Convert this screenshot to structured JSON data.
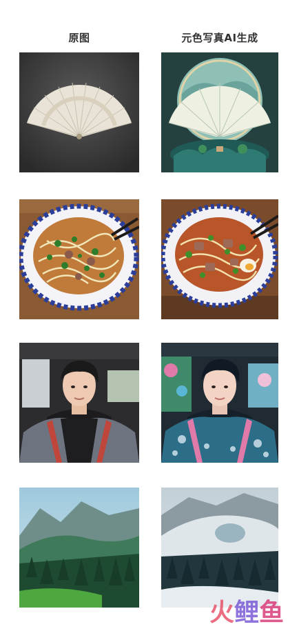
{
  "headers": {
    "original": "原图",
    "generated": "元色写真AI生成"
  },
  "rows": [
    {
      "subject": "fan",
      "original_alt": "fan-original",
      "generated_alt": "fan-generated"
    },
    {
      "subject": "noodles",
      "original_alt": "noodles-original",
      "generated_alt": "noodles-generated"
    },
    {
      "subject": "portrait",
      "original_alt": "portrait-original",
      "generated_alt": "portrait-generated"
    },
    {
      "subject": "landscape",
      "original_alt": "landscape-original",
      "generated_alt": "landscape-generated"
    }
  ],
  "watermark": {
    "chars": [
      "火",
      "鲤",
      "鱼"
    ],
    "colors": [
      "#e8546c",
      "#7b5bd6",
      "#d93d7a"
    ]
  }
}
